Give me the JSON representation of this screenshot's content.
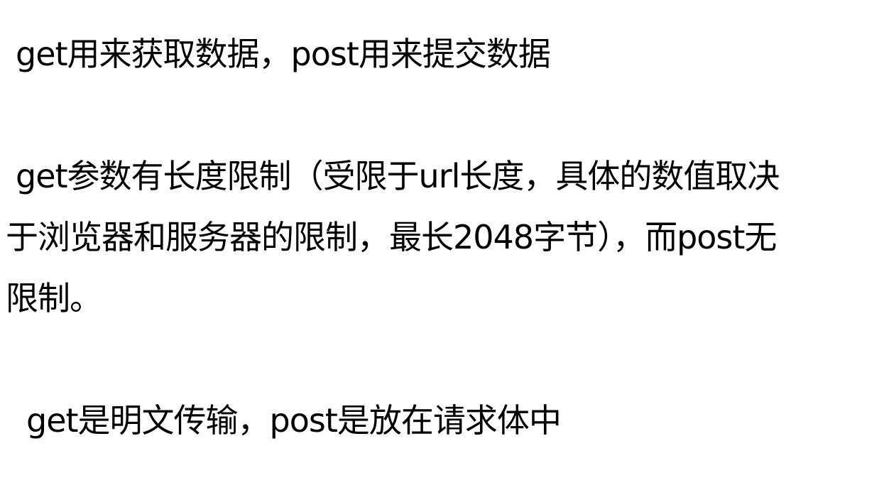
{
  "paragraphs": {
    "p1": "get用来获取数据，post用来提交数据",
    "p2_line1": "get参数有长度限制（受限于url长度，具体的数值取决",
    "p2_line2": "于浏览器和服务器的限制，最长2048字节），而post无",
    "p2_line3": "限制。",
    "p3": "get是明文传输，post是放在请求体中"
  }
}
